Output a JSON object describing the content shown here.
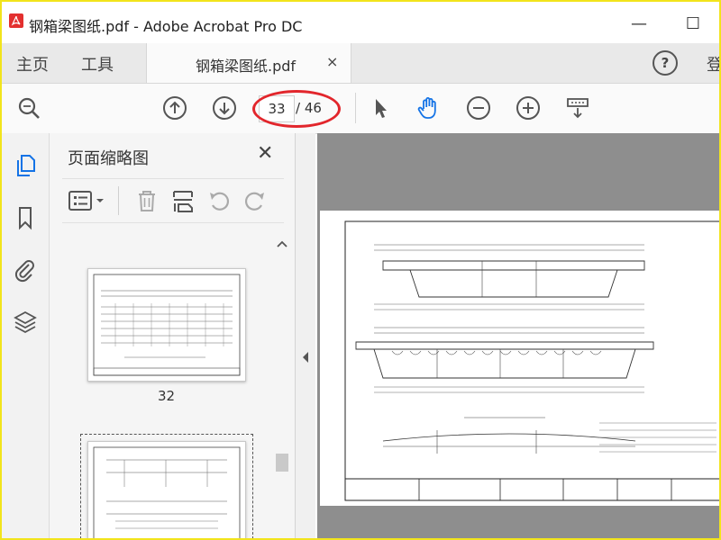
{
  "window": {
    "title": "钢箱梁图纸.pdf - Adobe Acrobat Pro DC",
    "minimize_glyph": "—",
    "maximize_glyph": "☐"
  },
  "tabs": {
    "home": "主页",
    "tools": "工具",
    "document": "钢箱梁图纸.pdf",
    "close_glyph": "×",
    "help_glyph": "?",
    "signin": "登"
  },
  "toolbar": {
    "current_page": "33",
    "total_pages": "/ 46",
    "icons": [
      "search-zoom-icon",
      "previous-page-icon",
      "next-page-icon",
      "select-arrow-icon",
      "hand-tool-icon",
      "zoom-out-icon",
      "zoom-in-icon",
      "page-display-icon"
    ]
  },
  "rail": {
    "icons": [
      "page-thumbnails-icon",
      "bookmarks-icon",
      "attachments-icon",
      "layers-icon"
    ]
  },
  "panel": {
    "title": "页面缩略图",
    "close_glyph": "✕",
    "thumb_labels": [
      "32"
    ]
  },
  "colors": {
    "accent": "#1473e6",
    "highlight_ellipse": "#e2262c",
    "frame": "#f2e41c",
    "doc_background": "#8e8e8e"
  }
}
